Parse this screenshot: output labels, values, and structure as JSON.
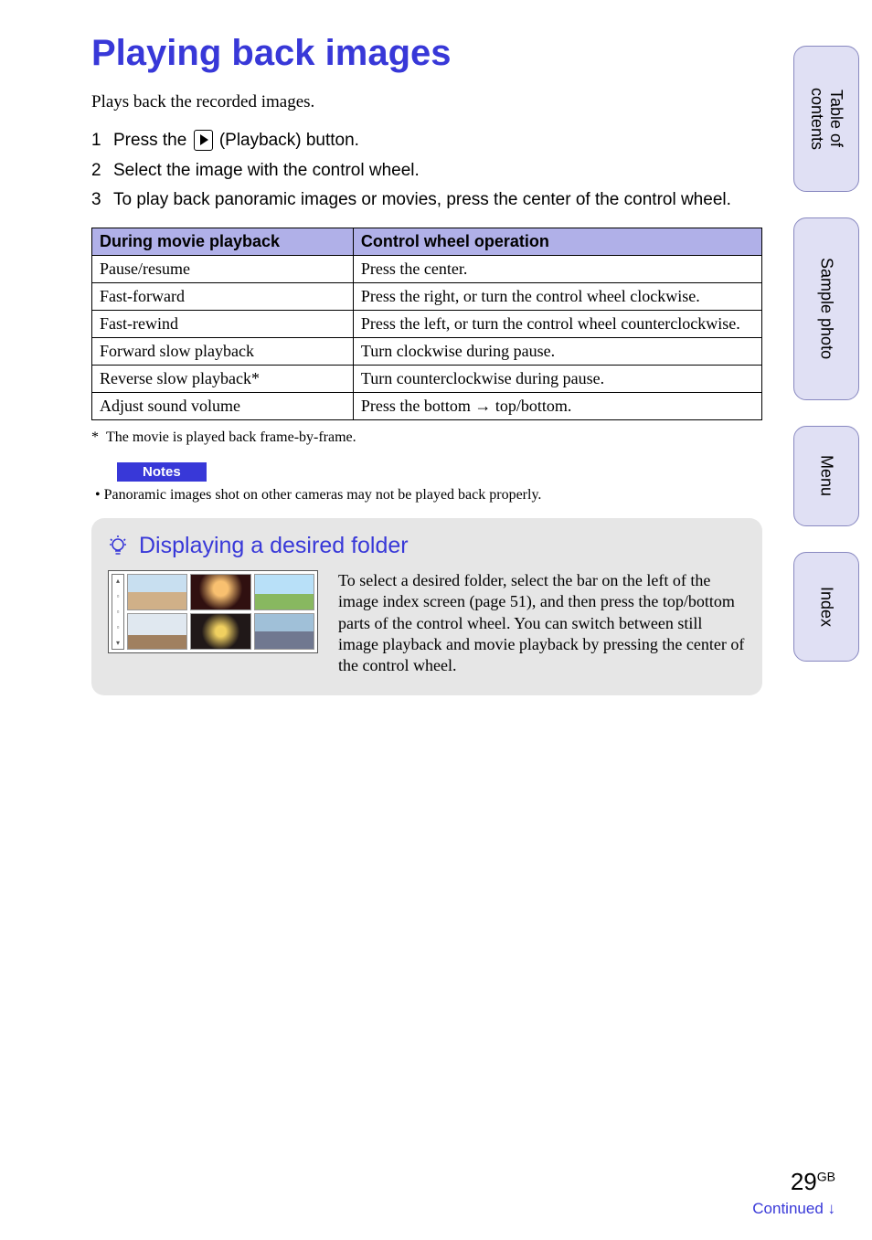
{
  "title": "Playing back images",
  "intro": "Plays back the recorded images.",
  "steps": [
    {
      "num": "1",
      "pre": "Press the ",
      "post": " (Playback) button.",
      "has_icon": true
    },
    {
      "num": "2",
      "pre": "Select the image with the control wheel.",
      "post": "",
      "has_icon": false
    },
    {
      "num": "3",
      "pre": "To play back panoramic images or movies, press the center of the control wheel.",
      "post": "",
      "has_icon": false
    }
  ],
  "table": {
    "headers": [
      "During movie playback",
      "Control wheel operation"
    ],
    "rows": [
      [
        "Pause/resume",
        "Press the center."
      ],
      [
        "Fast-forward",
        "Press the right, or turn the control wheel clockwise."
      ],
      [
        "Fast-rewind",
        "Press the left, or turn the control wheel counterclockwise."
      ],
      [
        "Forward slow playback",
        "Turn clockwise during pause."
      ],
      [
        "Reverse slow playback*",
        "Turn counterclockwise during pause."
      ],
      [
        "Adjust sound volume",
        "Press the bottom → top/bottom."
      ]
    ]
  },
  "footnote": {
    "mark": "*",
    "text": "The movie is played back frame-by-frame."
  },
  "notes": {
    "label": "Notes",
    "items": [
      "Panoramic images shot on other cameras may not be played back properly."
    ]
  },
  "tip": {
    "title": "Displaying a desired folder",
    "text": "To select a desired folder, select the bar on the left of the image index screen (page 51), and then press the top/bottom parts of the control wheel. You can switch between still image playback and movie playback by pressing the center of the control wheel."
  },
  "side_tabs": {
    "toc": "Table of contents",
    "sample": "Sample photo",
    "menu": "Menu",
    "index": "Index"
  },
  "footer": {
    "page": "29",
    "region": "GB",
    "continued": "Continued ↓"
  }
}
